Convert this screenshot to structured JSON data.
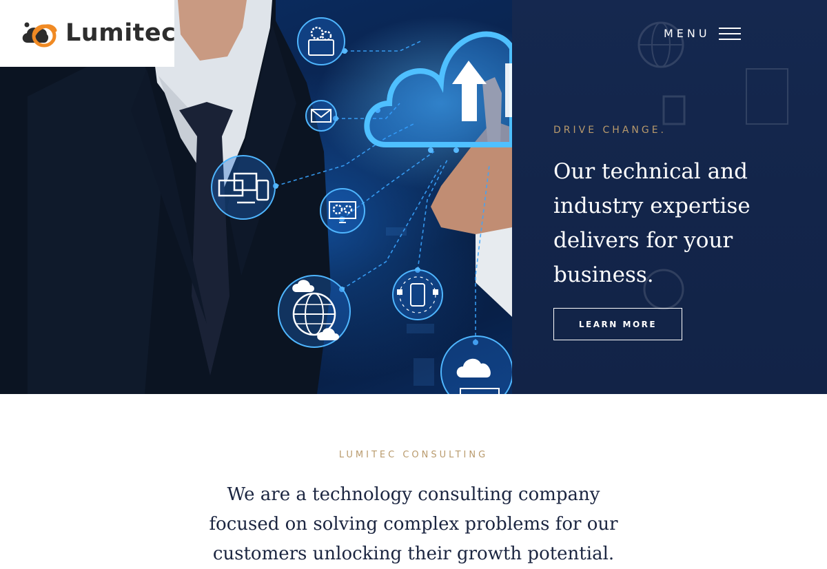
{
  "brand": {
    "name": "Lumitec",
    "colors": {
      "orange": "#f08a24",
      "dark": "#2d2d2d",
      "navy": "#13254a",
      "gold": "#b99a6c"
    }
  },
  "nav": {
    "menu_label": "MENU",
    "menu_icon": "hamburger-icon"
  },
  "hero": {
    "eyebrow": "DRIVE CHANGE.",
    "headline": "Our technical and industry expertise delivers for your business.",
    "cta_label": "LEARN MORE",
    "image_icons": [
      "gears-tablet-icon",
      "mail-icon",
      "devices-icon",
      "settings-monitor-icon",
      "cloud-upload-icon",
      "globe-icon",
      "phone-sync-icon",
      "cloud-server-icon"
    ]
  },
  "about": {
    "eyebrow": "LUMITEC CONSULTING",
    "text": "We are a technology consulting company focused on solving complex problems for our customers unlocking their growth potential."
  }
}
